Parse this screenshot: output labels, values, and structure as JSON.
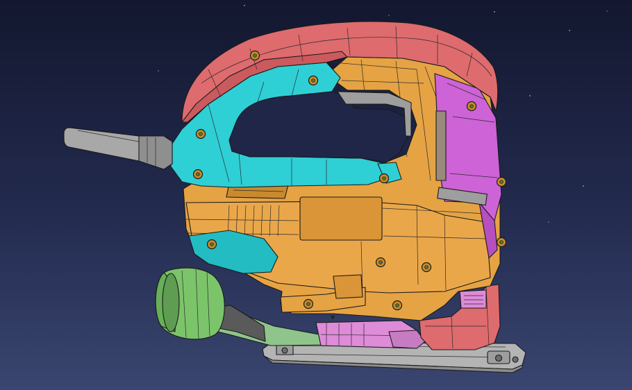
{
  "scene": {
    "subject": "jigsaw-cad-assembly",
    "background_colors": [
      "#13172f",
      "#232b4f",
      "#3a4670"
    ],
    "part_colors": {
      "handle_top": "#de6b6e",
      "grip_overmold": "#2fcfd6",
      "housing": "#e5a344",
      "side_cover": "#cd63d6",
      "dust_port": "#7cc46a",
      "power_cord": "#a8a8a8",
      "base_plate": "#b4b4b4",
      "blade_guard": "#de8bd8",
      "screw": "#c98a2e"
    }
  },
  "parts": [
    {
      "name": "power-cord"
    },
    {
      "name": "handle-top-cover"
    },
    {
      "name": "grip-overmold"
    },
    {
      "name": "main-housing"
    },
    {
      "name": "side-cover"
    },
    {
      "name": "dust-port"
    },
    {
      "name": "base-plate"
    },
    {
      "name": "blade-guard"
    },
    {
      "name": "front-roller-cover"
    }
  ]
}
